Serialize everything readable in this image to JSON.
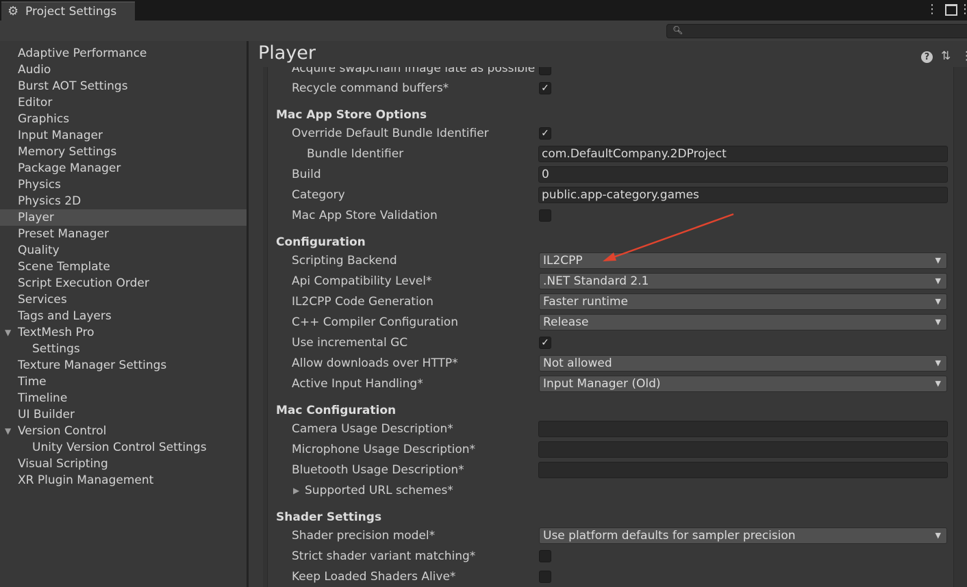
{
  "window": {
    "tab_title": "Project Settings",
    "icons": [
      "gear-icon",
      "more-options-icon",
      "maximize-icon"
    ]
  },
  "search": {
    "placeholder": "",
    "value": ""
  },
  "sidebar": {
    "items": [
      {
        "label": "Adaptive Performance"
      },
      {
        "label": "Audio"
      },
      {
        "label": "Burst AOT Settings"
      },
      {
        "label": "Editor"
      },
      {
        "label": "Graphics"
      },
      {
        "label": "Input Manager"
      },
      {
        "label": "Memory Settings"
      },
      {
        "label": "Package Manager"
      },
      {
        "label": "Physics"
      },
      {
        "label": "Physics 2D"
      },
      {
        "label": "Player",
        "selected": true
      },
      {
        "label": "Preset Manager"
      },
      {
        "label": "Quality"
      },
      {
        "label": "Scene Template"
      },
      {
        "label": "Script Execution Order"
      },
      {
        "label": "Services"
      },
      {
        "label": "Tags and Layers"
      },
      {
        "label": "TextMesh Pro",
        "expanded": true
      },
      {
        "label": "Settings",
        "child": true
      },
      {
        "label": "Texture Manager Settings"
      },
      {
        "label": "Time"
      },
      {
        "label": "Timeline"
      },
      {
        "label": "UI Builder"
      },
      {
        "label": "Version Control",
        "expanded": true
      },
      {
        "label": "Unity Version Control Settings",
        "child": true
      },
      {
        "label": "Visual Scripting"
      },
      {
        "label": "XR Plugin Management"
      }
    ]
  },
  "main": {
    "title": "Player",
    "top_rows": {
      "acquire_swapchain": {
        "label": "Acquire swapchain image late as possible",
        "checked": false
      },
      "recycle_buffers": {
        "label": "Recycle command buffers*",
        "checked": true
      }
    },
    "mac_app_store": {
      "header": "Mac App Store Options",
      "override_bundle": {
        "label": "Override Default Bundle Identifier",
        "checked": true
      },
      "bundle_identifier": {
        "label": "Bundle Identifier",
        "value": "com.DefaultCompany.2DProject"
      },
      "build": {
        "label": "Build",
        "value": "0"
      },
      "category": {
        "label": "Category",
        "value": "public.app-category.games"
      },
      "validation": {
        "label": "Mac App Store Validation",
        "checked": false
      }
    },
    "configuration": {
      "header": "Configuration",
      "scripting_backend": {
        "label": "Scripting Backend",
        "value": "IL2CPP"
      },
      "api_level": {
        "label": "Api Compatibility Level*",
        "value": ".NET Standard 2.1"
      },
      "il2cpp_codegen": {
        "label": "IL2CPP Code Generation",
        "value": "Faster runtime"
      },
      "cpp_compiler": {
        "label": "C++ Compiler Configuration",
        "value": "Release"
      },
      "incremental_gc": {
        "label": "Use incremental GC",
        "checked": true
      },
      "downloads_http": {
        "label": "Allow downloads over HTTP*",
        "value": "Not allowed"
      },
      "input_handling": {
        "label": "Active Input Handling*",
        "value": "Input Manager (Old)"
      }
    },
    "mac_configuration": {
      "header": "Mac Configuration",
      "camera_usage": {
        "label": "Camera Usage Description*",
        "value": ""
      },
      "microphone_usage": {
        "label": "Microphone Usage Description*",
        "value": ""
      },
      "bluetooth_usage": {
        "label": "Bluetooth Usage Description*",
        "value": ""
      },
      "url_schemes": {
        "label": "Supported URL schemes*"
      }
    },
    "shader_settings": {
      "header": "Shader Settings",
      "precision_model": {
        "label": "Shader precision model*",
        "value": "Use platform defaults for sampler precision"
      },
      "strict_variant": {
        "label": "Strict shader variant matching*",
        "checked": false
      },
      "keep_loaded": {
        "label": "Keep Loaded Shaders Alive*",
        "checked": false
      }
    },
    "annotation_color": "#e0442e"
  }
}
